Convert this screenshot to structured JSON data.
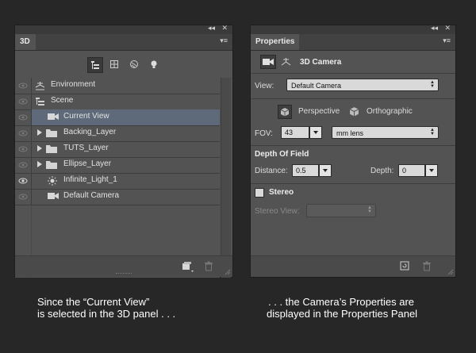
{
  "panel3d": {
    "tab_label": "3D",
    "collapse_glyph": "◂◂",
    "close_glyph": "✕",
    "menu_glyph": "▾≡",
    "tools": [
      {
        "icon": "scene-filter-icon",
        "active": true
      },
      {
        "icon": "mesh-filter-icon",
        "active": false
      },
      {
        "icon": "materials-filter-icon",
        "active": false
      },
      {
        "icon": "lights-filter-icon",
        "active": false
      }
    ],
    "layers": [
      {
        "label": "Environment",
        "icon": "environment-icon",
        "indent": 0,
        "expander": false,
        "eye": true,
        "selected": false
      },
      {
        "label": "Scene",
        "icon": "scene-icon",
        "indent": 0,
        "expander": false,
        "eye": true,
        "selected": false
      },
      {
        "label": "Current View",
        "icon": "camera-icon",
        "indent": 1,
        "expander": false,
        "eye": true,
        "selected": true
      },
      {
        "label": "Backing_Layer",
        "icon": "folder-icon",
        "indent": 1,
        "expander": true,
        "eye": true,
        "selected": false
      },
      {
        "label": "TUTS_Layer",
        "icon": "folder-icon",
        "indent": 1,
        "expander": true,
        "eye": true,
        "selected": false
      },
      {
        "label": "Ellipse_Layer",
        "icon": "folder-icon",
        "indent": 1,
        "expander": true,
        "eye": true,
        "selected": false
      },
      {
        "label": "Infinite_Light_1",
        "icon": "light-icon",
        "indent": 1,
        "expander": false,
        "eye": true,
        "selected": false
      },
      {
        "label": "Default Camera",
        "icon": "camera-icon",
        "indent": 1,
        "expander": false,
        "eye": true,
        "selected": false
      }
    ]
  },
  "properties": {
    "tab_label": "Properties",
    "collapse_glyph": "◂◂",
    "close_glyph": "✕",
    "menu_glyph": "▾≡",
    "title": "3D Camera",
    "view_label": "View:",
    "view_value": "Default Camera",
    "perspective_label": "Perspective",
    "orthographic_label": "Orthographic",
    "fov_label": "FOV:",
    "fov_value": "43",
    "lens_value": "mm lens",
    "dof_title": "Depth Of Field",
    "distance_label": "Distance:",
    "distance_value": "0.5",
    "depth_label": "Depth:",
    "depth_value": "0",
    "stereo_label": "Stereo",
    "stereo_checked": false,
    "stereo_view_label": "Stereo View:",
    "stereo_view_value": ""
  },
  "captions": {
    "left_line1": "Since the “Current View”",
    "left_line2": "is selected in the 3D panel . . .",
    "right_line1": ". . . the Camera’s Properties are",
    "right_line2": "displayed in the Properties Panel"
  }
}
